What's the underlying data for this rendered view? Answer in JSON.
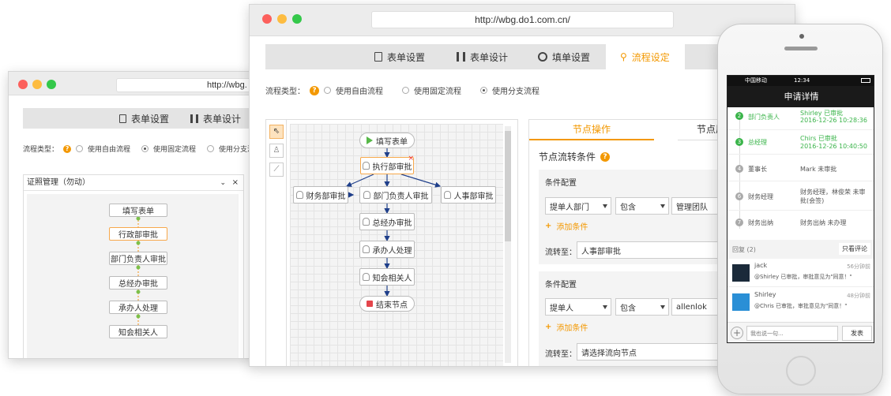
{
  "left_window": {
    "url": "http://wbg.",
    "tabs": [
      "表单设置",
      "表单设计"
    ],
    "flow_type_label": "流程类型：",
    "radio_options": [
      "使用自由流程",
      "使用固定流程",
      "使用分支流"
    ],
    "panel_title": "证照管理（勿动）",
    "nodes": [
      "填写表单",
      "行政部审批",
      "部门负责人审批",
      "总经办审批",
      "承办人处理",
      "知会相关人"
    ]
  },
  "main_window": {
    "url": "http://wbg.do1.com.cn/",
    "tabs": [
      "表单设置",
      "表单设计",
      "填单设置",
      "流程设定"
    ],
    "flow_type_label": "流程类型：",
    "radio_options": [
      "使用自由流程",
      "使用固定流程",
      "使用分支流程"
    ],
    "flow_nodes": {
      "start": "填写表单",
      "admin": "执行部审批",
      "finance": "财务部审批",
      "dept": "部门负责人审批",
      "hr": "人事部审批",
      "ceo": "总经办审批",
      "handler": "承办人处理",
      "notify": "知会相关人",
      "end": "结束节点"
    },
    "right_tabs": [
      "节点操作",
      "节点属"
    ],
    "condition_title": "节点流转条件",
    "cond1": {
      "header": "条件配置",
      "field": "提单人部门",
      "op": "包含",
      "value": "管理团队",
      "add": "添加条件",
      "goto_label": "流转至：",
      "goto_value": "人事部审批"
    },
    "cond2": {
      "header": "条件配置",
      "field": "提单人",
      "op": "包含",
      "value": "allenlok",
      "add": "添加条件",
      "goto_label": "流转至：",
      "goto_value": "请选择流向节点"
    }
  },
  "phone": {
    "carrier": "中国移动",
    "time": "12:34",
    "title": "申请详情",
    "steps": [
      {
        "num": "2",
        "role": "部门负责人",
        "line1": "Shirley 已审批",
        "line2": "2016-12-26 10:28:36"
      },
      {
        "num": "3",
        "role": "总经理",
        "line1": "Chirs 已审批",
        "line2": "2016-12-26 10:40:50"
      },
      {
        "num": "4",
        "role": "董事长",
        "line1": "Mark 未审批",
        "line2": ""
      },
      {
        "num": "6",
        "role": "财务经理",
        "line1": "财务经理，林俊荣 未审",
        "line2": "批(会签)"
      },
      {
        "num": "7",
        "role": "财务出纳",
        "line1": "财务出纳 未办理",
        "line2": ""
      }
    ],
    "reply_label": "回复 (2)",
    "only_comments": "只看评论",
    "comments": [
      {
        "name": "jack",
        "time": "56分钟前",
        "text": "@Shirley 已审批，审批意见为\"同意！\""
      },
      {
        "name": "Shirley",
        "time": "48分钟前",
        "text": "@Chris 已审批，审批意见为\"同意！\""
      }
    ],
    "input_placeholder": "我也说一句...",
    "send": "发表"
  }
}
